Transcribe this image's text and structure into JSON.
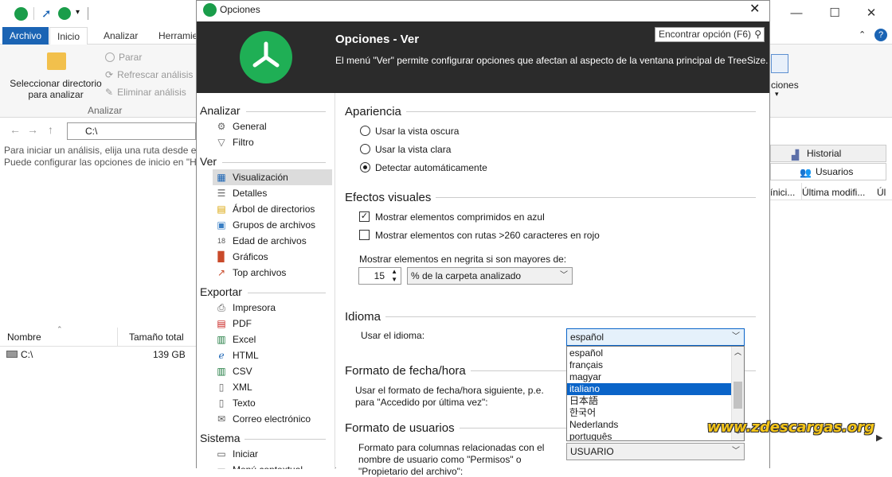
{
  "main_window": {
    "ribbon_tabs": [
      "Archivo",
      "Inicio",
      "Analizar",
      "Herramie"
    ],
    "select_dir_label": "Seleccionar directorio para analizar",
    "stop_label": "Parar",
    "refresh_label": "Refrescar análisis",
    "remove_label": "Eliminar análisis",
    "group_label": "Analizar",
    "right_group_label": "ciones",
    "path": "C:\\",
    "info_line1": "Para iniciar un análisis, elija una ruta desde el",
    "info_line2": "Puede configurar las opciones de inicio en \"H",
    "col_name": "Nombre",
    "col_size": "Tamaño total",
    "row_name": "C:\\",
    "row_size": "139 GB",
    "history_tab": "Historial",
    "users_tab": "Usuarios",
    "col_inici": "ínici...",
    "col_last_mod": "Última modifi...",
    "col_ul": "Úl"
  },
  "dialog": {
    "title": "Opciones",
    "header_title": "Opciones - Ver",
    "header_desc": "El menú \"Ver\" permite configurar opciones que afectan al aspecto de la ventana principal de TreeSize.",
    "search_placeholder": "Encontrar opción (F6)",
    "nav": {
      "analizar": "Analizar",
      "general": "General",
      "filtro": "Filtro",
      "ver": "Ver",
      "visualizacion": "Visualización",
      "detalles": "Detalles",
      "arbol": "Árbol de directorios",
      "grupos": "Grupos de archivos",
      "edad": "Edad de archivos",
      "graficos": "Gráficos",
      "top": "Top archivos",
      "exportar": "Exportar",
      "impresora": "Impresora",
      "pdf": "PDF",
      "excel": "Excel",
      "html": "HTML",
      "csv": "CSV",
      "xml": "XML",
      "texto": "Texto",
      "correo": "Correo electrónico",
      "sistema": "Sistema",
      "iniciar": "Iniciar",
      "menu_ctx": "Menú contextual"
    },
    "apariencia": {
      "title": "Apariencia",
      "dark": "Usar la vista oscura",
      "light": "Usar la vista clara",
      "auto": "Detectar automáticamente"
    },
    "efectos": {
      "title": "Efectos visuales",
      "compressed": "Mostrar elementos comprimidos en azul",
      "long_paths": "Mostrar elementos con rutas >260 caracteres en rojo",
      "bold_label": "Mostrar elementos en negrita si son mayores de:",
      "bold_value": "15",
      "bold_unit": "% de la carpeta analizado"
    },
    "idioma": {
      "title": "Idioma",
      "label": "Usar el idioma:",
      "selected": "español",
      "options": [
        "español",
        "français",
        "magyar",
        "italiano",
        "日本語",
        "한국어",
        "Nederlands",
        "português"
      ],
      "highlighted_index": 3
    },
    "fecha": {
      "title": "Formato de fecha/hora",
      "line1": "Usar el formato de fecha/hora siguiente, p.e.",
      "line2": "para \"Accedido por última vez\":"
    },
    "usuarios": {
      "title": "Formato de usuarios",
      "line1": "Formato para columnas relacionadas con el",
      "line2": "nombre de usuario como \"Permisos\" o",
      "line3": "\"Propietario del archivo\":",
      "value": "USUARIO"
    }
  },
  "watermark": "www.zdescargas.org",
  "colors": {
    "brand_green": "#1faf55",
    "header_bg": "#2b2b2b",
    "file_tab": "#1b64b4",
    "selection": "#0a64c8"
  }
}
